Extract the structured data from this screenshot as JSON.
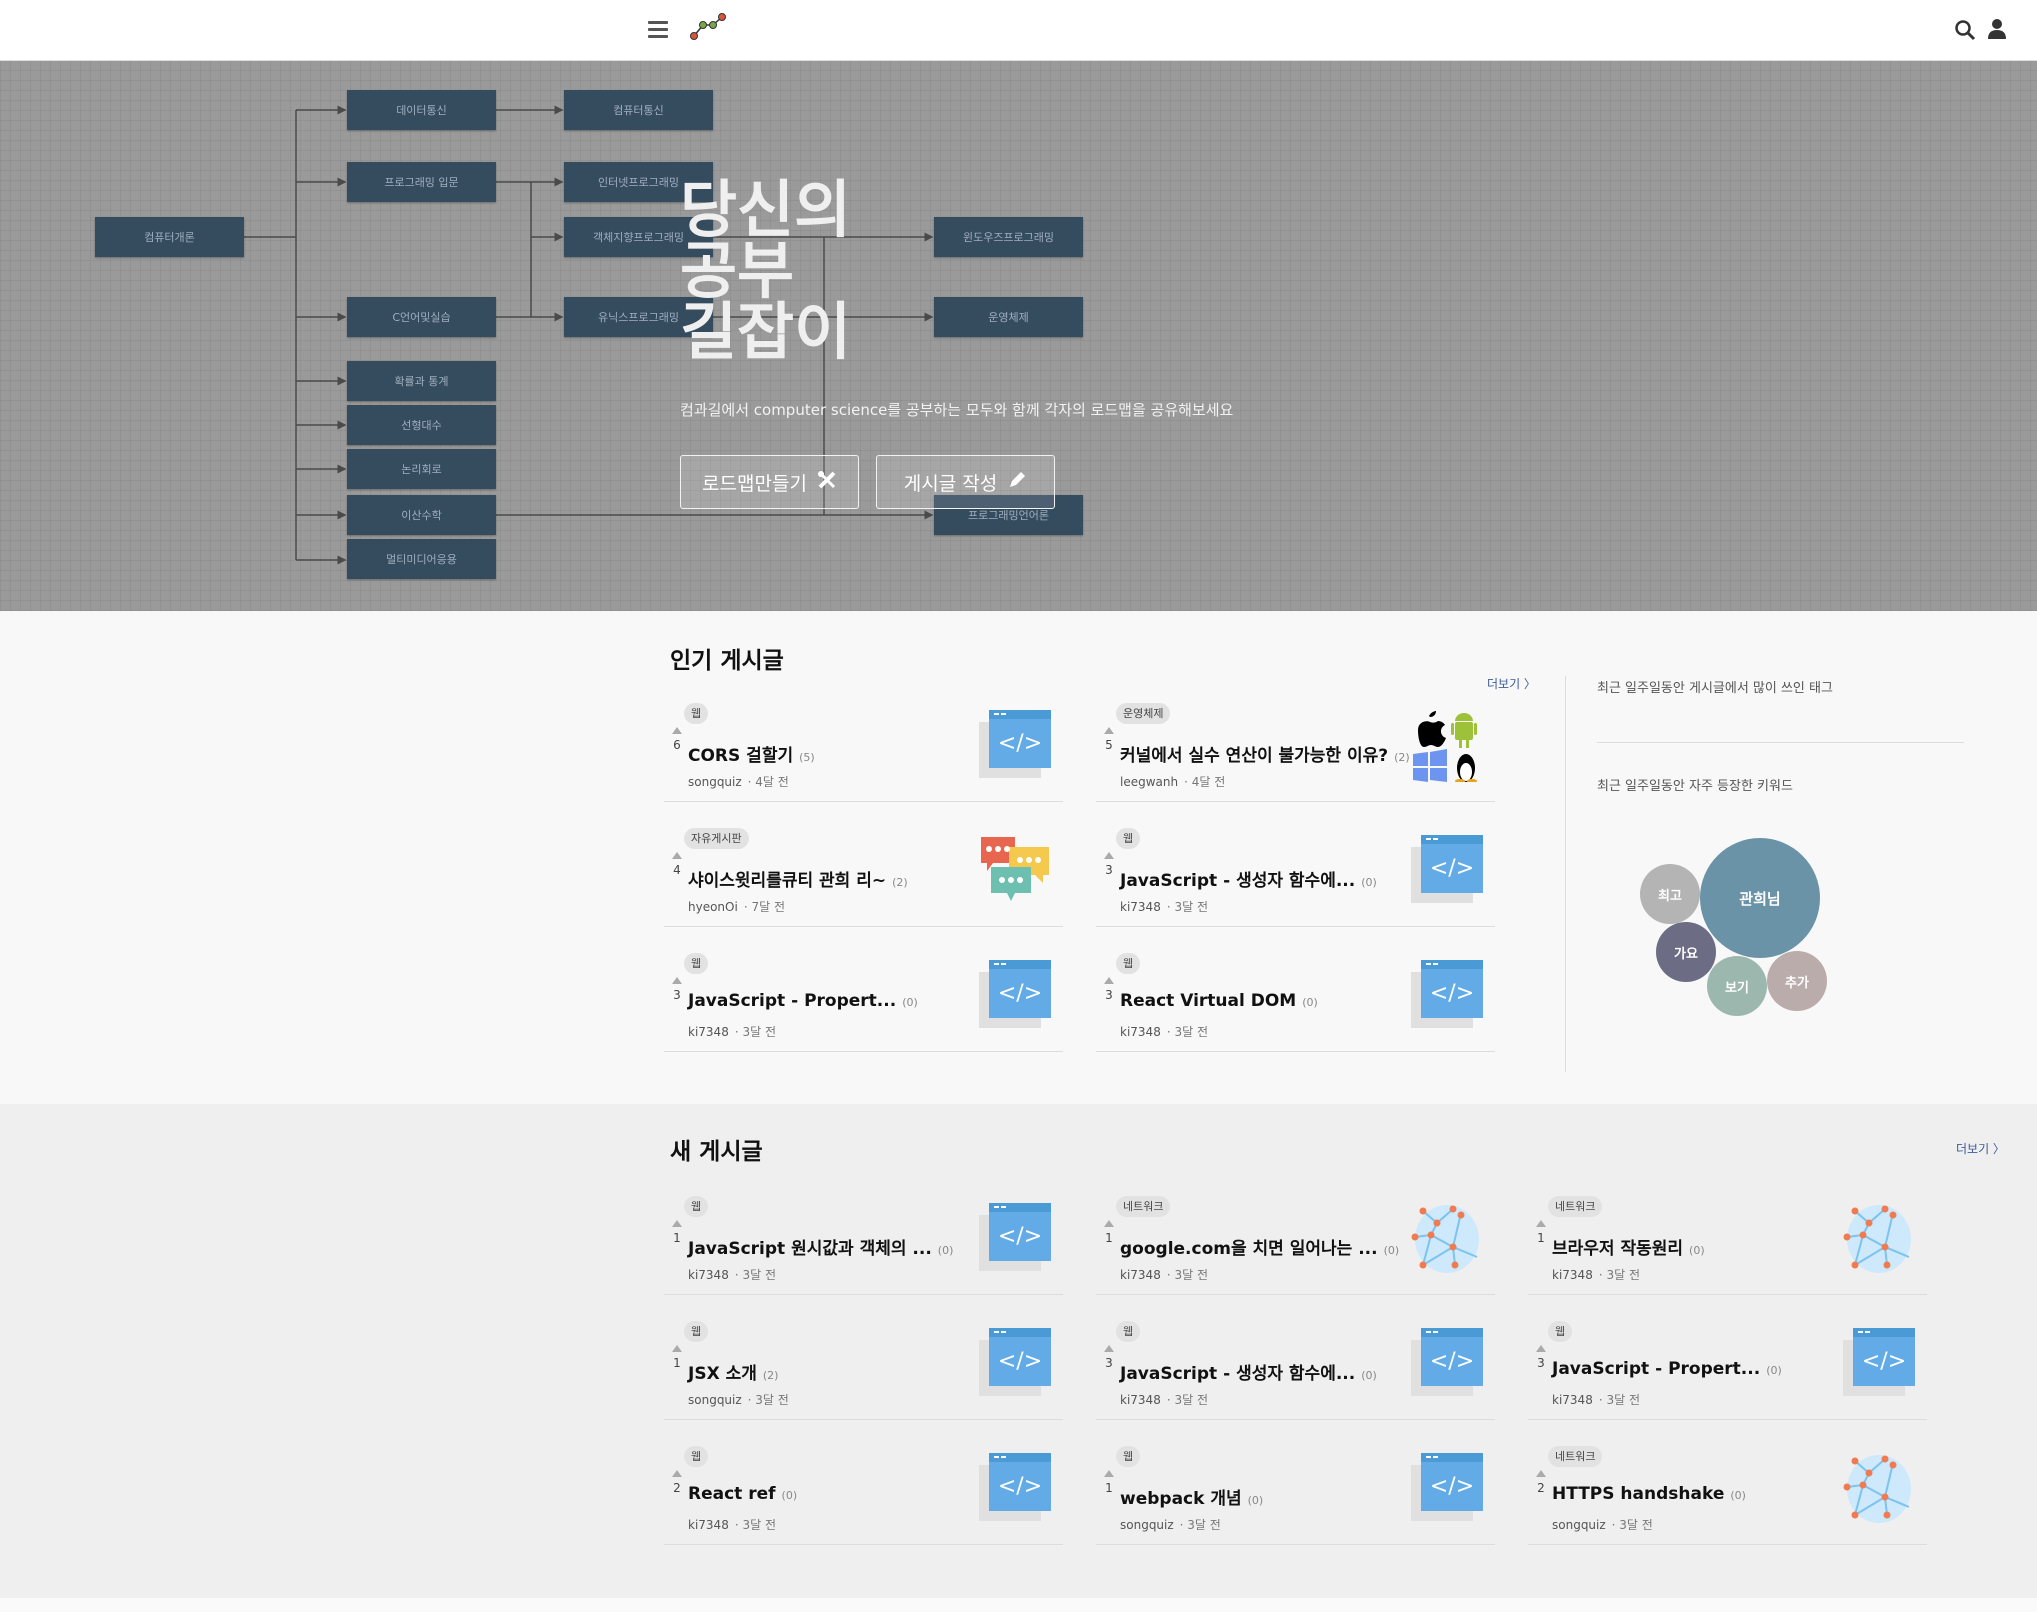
{
  "header": {
    "menu_icon": "hamburger-icon",
    "logo_icon": "roadmap-logo-icon",
    "search_icon": "search-icon",
    "user_icon": "user-icon"
  },
  "hero": {
    "title_lines": [
      "당신의",
      "공부",
      "길잡이"
    ],
    "subtitle": "컴과길에서 computer science를 공부하는 모두와 함께 각자의 로드맵을 공유해보세요",
    "buttons": [
      {
        "label": "로드맵만들기",
        "icon": "tools-icon"
      },
      {
        "label": "게시글 작성",
        "icon": "pencil-icon"
      }
    ],
    "roadmap_nodes": [
      "컴퓨터개론",
      "데이터통신",
      "프로그래밍 입문",
      "C언어및실습",
      "확률과 통계",
      "선형대수",
      "논리회로",
      "이산수학",
      "멀티미디어응용",
      "컴퓨터통신",
      "인터넷프로그래밍",
      "객체지향프로그래밍",
      "유닉스프로그래밍",
      "윈도우즈프로그래밍",
      "운영체제",
      "프로그래밍언어론"
    ]
  },
  "popular": {
    "title": "인기 게시글",
    "more": "더보기 〉",
    "posts": [
      {
        "tag": "웹",
        "votes": "6",
        "title": "CORS 걸할기",
        "comments": "(5)",
        "author": "songquiz",
        "time": "· 4달 전",
        "image": "code"
      },
      {
        "tag": "운영체제",
        "votes": "5",
        "title": "커널에서 실수 연산이 불가능한 이유?",
        "comments": "(2)",
        "author": "leegwanh",
        "time": "· 4달 전",
        "image": "os"
      },
      {
        "tag": "자유게시판",
        "votes": "4",
        "title": "샤이스윗리를큐티 관희 리~",
        "comments": "(2)",
        "author": "hyeonOi",
        "time": "· 7달 전",
        "image": "chat"
      },
      {
        "tag": "웹",
        "votes": "3",
        "title": "JavaScript - 생성자 함수에...",
        "comments": "(0)",
        "author": "ki7348",
        "time": "· 3달 전",
        "image": "code"
      },
      {
        "tag": "웹",
        "votes": "3",
        "title": "JavaScript - Propert...",
        "comments": "(0)",
        "author": "ki7348",
        "time": "· 3달 전",
        "image": "code"
      },
      {
        "tag": "웹",
        "votes": "3",
        "title": "React Virtual DOM",
        "comments": "(0)",
        "author": "ki7348",
        "time": "· 3달 전",
        "image": "code"
      }
    ]
  },
  "sidebar": {
    "tags_title": "최근 일주일동안 게시글에서 많이 쓰인 태그",
    "keywords_title": "최근 일주일동안 자주 등장한 키워드",
    "keywords": [
      {
        "label": "관희님",
        "color": "#6b93a8",
        "weight": 2
      },
      {
        "label": "최고",
        "color": "#b4b4b4",
        "weight": 1
      },
      {
        "label": "가요",
        "color": "#6c6c85",
        "weight": 1
      },
      {
        "label": "보기",
        "color": "#9cb8ae",
        "weight": 1
      },
      {
        "label": "추가",
        "color": "#baacab",
        "weight": 1
      }
    ]
  },
  "newposts": {
    "title": "새 게시글",
    "more": "더보기 〉",
    "posts": [
      {
        "tag": "웹",
        "votes": "1",
        "title": "JavaScript 원시값과 객체의 ...",
        "comments": "(0)",
        "author": "ki7348",
        "time": "· 3달 전",
        "image": "code"
      },
      {
        "tag": "네트워크",
        "votes": "1",
        "title": "google.com을 치면 일어나는 ...",
        "comments": "(0)",
        "author": "ki7348",
        "time": "· 3달 전",
        "image": "network"
      },
      {
        "tag": "네트워크",
        "votes": "1",
        "title": "브라우저 작동원리",
        "comments": "(0)",
        "author": "ki7348",
        "time": "· 3달 전",
        "image": "network"
      },
      {
        "tag": "웹",
        "votes": "1",
        "title": "JSX 소개",
        "comments": "(2)",
        "author": "songquiz",
        "time": "· 3달 전",
        "image": "code"
      },
      {
        "tag": "웹",
        "votes": "3",
        "title": "JavaScript - 생성자 함수에...",
        "comments": "(0)",
        "author": "ki7348",
        "time": "· 3달 전",
        "image": "code"
      },
      {
        "tag": "웹",
        "votes": "3",
        "title": "JavaScript - Propert...",
        "comments": "(0)",
        "author": "ki7348",
        "time": "· 3달 전",
        "image": "code"
      },
      {
        "tag": "웹",
        "votes": "2",
        "title": "React ref",
        "comments": "(0)",
        "author": "ki7348",
        "time": "· 3달 전",
        "image": "code"
      },
      {
        "tag": "웹",
        "votes": "1",
        "title": "webpack 개념",
        "comments": "(0)",
        "author": "songquiz",
        "time": "· 3달 전",
        "image": "code"
      },
      {
        "tag": "네트워크",
        "votes": "2",
        "title": "HTTPS handshake",
        "comments": "(0)",
        "author": "songquiz",
        "time": "· 3달 전",
        "image": "network"
      }
    ]
  },
  "colors": {
    "node": "#354b5e",
    "accent_link": "#3d5c99",
    "code_blue": "#62abe6"
  }
}
